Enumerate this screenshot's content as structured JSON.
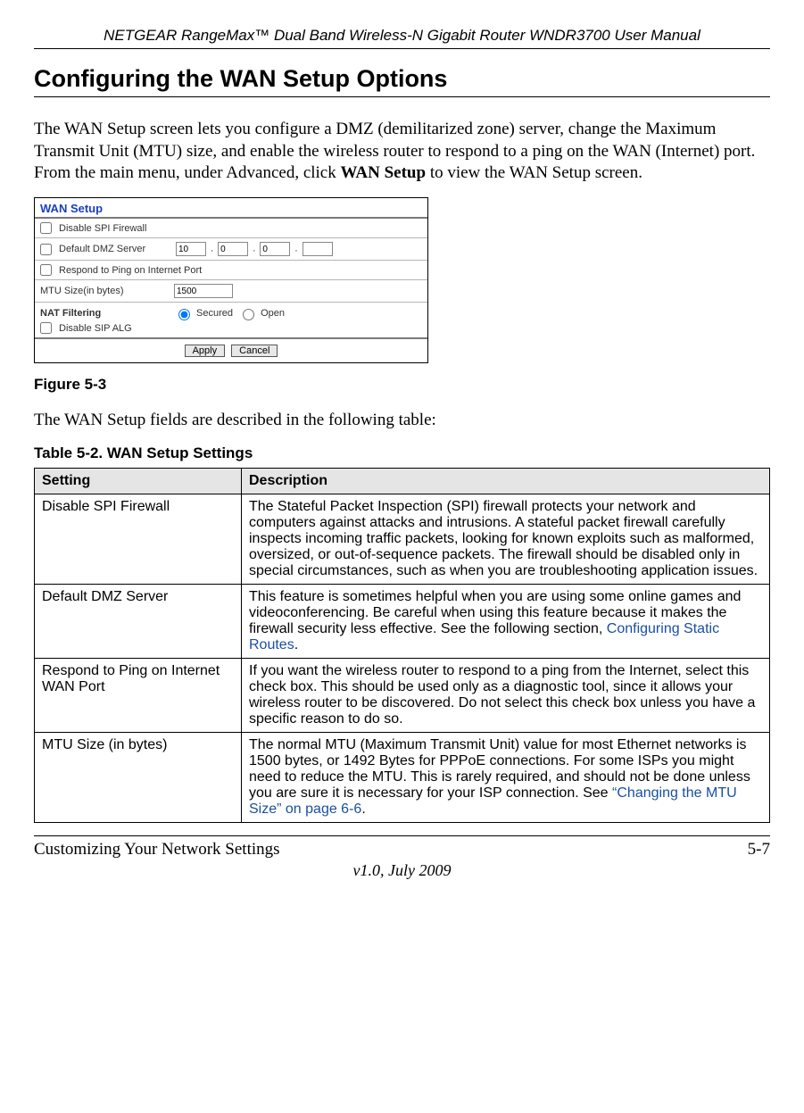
{
  "header": {
    "running": "NETGEAR RangeMax™ Dual Band Wireless-N Gigabit Router WNDR3700 User Manual"
  },
  "section": {
    "title": "Configuring the WAN Setup Options",
    "intro_a": "The WAN Setup screen lets you configure a DMZ (demilitarized zone) server, change the Maximum Transmit Unit (MTU) size, and enable the wireless router to respond to a ping on the WAN (Internet) port. From the main menu, under Advanced, click ",
    "intro_bold": "WAN Setup",
    "intro_b": " to view the WAN Setup screen.",
    "after_figure": "The WAN Setup fields are described in the following table:"
  },
  "screenshot": {
    "title": "WAN Setup",
    "disable_spi": "Disable SPI Firewall",
    "default_dmz": "Default DMZ Server",
    "dmz_octets": [
      "10",
      "0",
      "0",
      ""
    ],
    "respond_ping": "Respond to Ping on Internet Port",
    "mtu_label": "MTU Size(in bytes)",
    "mtu_value": "1500",
    "nat_label": "NAT Filtering",
    "nat_secured": "Secured",
    "nat_open": "Open",
    "disable_sip": "Disable SIP ALG",
    "apply": "Apply",
    "cancel": "Cancel"
  },
  "figure_caption": "Figure 5-3",
  "table_caption": "Table 5-2.  WAN Setup Settings",
  "table": {
    "col1": "Setting",
    "col2": "Description",
    "rows": [
      {
        "setting": "Disable SPI Firewall",
        "desc": "The Stateful Packet Inspection (SPI) firewall protects your network and computers against attacks and intrusions. A stateful packet firewall carefully inspects incoming traffic packets, looking for known exploits such as malformed, oversized, or out-of-sequence packets. The firewall should be disabled only in special circumstances, such as when you are troubleshooting application issues."
      },
      {
        "setting": "Default DMZ Server",
        "desc_a": "This feature is sometimes helpful when you are using some online games and videoconferencing. Be careful when using this feature because it makes the firewall security less effective. See the following section, ",
        "link": "Configuring Static Routes",
        "desc_b": "."
      },
      {
        "setting": "Respond to Ping on Internet WAN Port",
        "desc": "If you want the wireless router to respond to a ping from the Internet, select this check box. This should be used only as a diagnostic tool, since it allows your wireless router to be discovered. Do not select this check box unless you have a specific reason to do so."
      },
      {
        "setting": "MTU Size (in bytes)",
        "desc_a": "The normal MTU (Maximum Transmit Unit) value for most Ethernet networks is 1500 bytes, or 1492 Bytes for PPPoE connections. For some ISPs you might need to reduce the MTU. This is rarely required, and should not be done unless you are sure it is necessary for your ISP connection. See ",
        "link": "“Changing the MTU Size” on page 6-6",
        "desc_b": "."
      }
    ]
  },
  "footer": {
    "left": "Customizing Your Network Settings",
    "right": "5-7",
    "version": "v1.0, July 2009"
  }
}
